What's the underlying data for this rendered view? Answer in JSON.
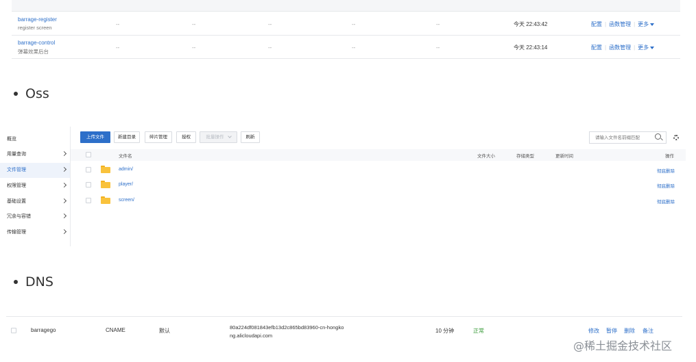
{
  "functions": {
    "rows": [
      {
        "name": "barrage-register",
        "desc": "register screen",
        "cells": [
          "--",
          "--",
          "--",
          "--",
          "--"
        ],
        "time": "今天 22:43:42"
      },
      {
        "name": "barrage-control",
        "desc": "弹幕效果后台",
        "cells": [
          "--",
          "--",
          "--",
          "--",
          "--"
        ],
        "time": "今天 22:43:14"
      }
    ],
    "actions": {
      "config": "配置",
      "manage": "函数管理",
      "more": "更多"
    }
  },
  "headings": {
    "oss": "Oss",
    "dns": "DNS"
  },
  "oss": {
    "sidebar": [
      {
        "label": "概览",
        "chevron": false
      },
      {
        "label": "用量查询",
        "chevron": true
      },
      {
        "label": "文件管理",
        "chevron": true,
        "active": true
      },
      {
        "label": "权限管理",
        "chevron": true
      },
      {
        "label": "基础设置",
        "chevron": true
      },
      {
        "label": "冗余与容错",
        "chevron": true
      },
      {
        "label": "传输管理",
        "chevron": true
      }
    ],
    "toolbar": {
      "upload": "上传文件",
      "new_dir": "新建目录",
      "fragments": "碎片管理",
      "authorize": "授权",
      "batch": "批量操作",
      "refresh": "刷新"
    },
    "search_placeholder": "请输入文件名前缀匹配",
    "columns": {
      "name": "文件名",
      "size": "文件大小",
      "storage": "存储类型",
      "updated": "更新时间",
      "action": "操作"
    },
    "files": [
      {
        "name": "admin/",
        "action": "彻底删除"
      },
      {
        "name": "player/",
        "action": "彻底删除"
      },
      {
        "name": "screen/",
        "action": "彻底删除"
      }
    ]
  },
  "dns": {
    "host": "barragego",
    "type": "CNAME",
    "line": "默认",
    "value_line1": "80a224df081843efb13d2c865bd83960-cn-hongko",
    "value_line2": "ng.alicloudapi.com",
    "ttl": "10 分钟",
    "status": "正常",
    "actions": [
      "修改",
      "暂停",
      "删除",
      "备注"
    ]
  },
  "watermark": "@稀土掘金技术社区"
}
